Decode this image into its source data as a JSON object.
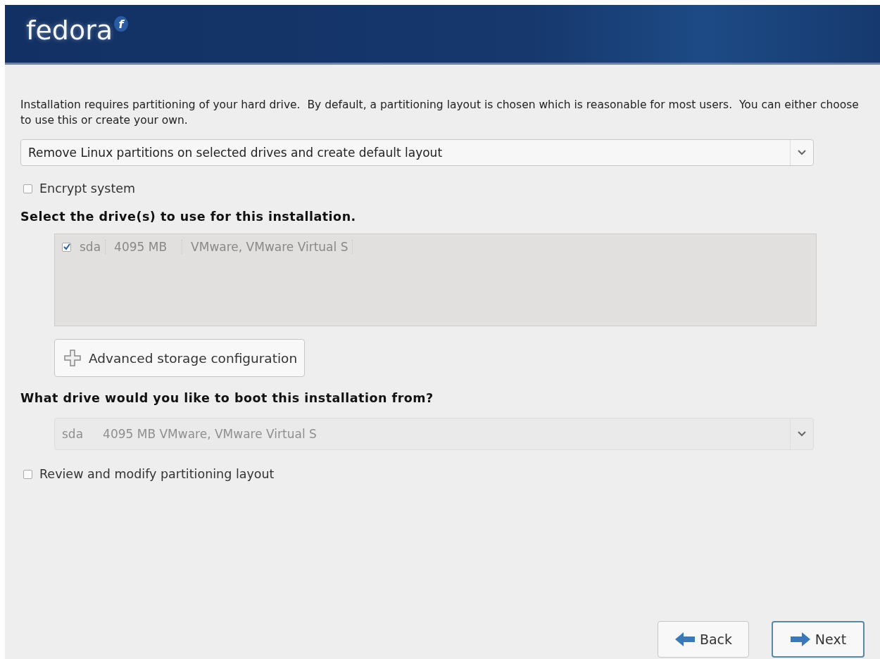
{
  "header": {
    "logo": "fedora",
    "logo_mark": "f"
  },
  "intro": "Installation requires partitioning of your hard drive.  By default, a partitioning layout is chosen which is reasonable for most users.  You can either choose to use this or create your own.",
  "layout_select": {
    "value": "Remove Linux partitions on selected drives and create default layout",
    "disabled": false
  },
  "encrypt": {
    "label": "Encrypt system",
    "checked": false
  },
  "drives_heading": "Select the drive(s) to use for this installation.",
  "drives": {
    "disabled": true,
    "rows": [
      {
        "checked": true,
        "cells": [
          "sda",
          "4095 MB",
          "VMware, VMware Virtual S"
        ]
      }
    ]
  },
  "advanced_button": "Advanced storage configuration",
  "boot_heading": "What drive would you like to boot this installation from?",
  "boot_select": {
    "disabled": true,
    "device": "sda",
    "description": "4095 MB VMware, VMware Virtual S"
  },
  "review": {
    "label": "Review and modify partitioning layout",
    "checked": false
  },
  "buttons": [
    {
      "kind": "back",
      "label": "Back",
      "selected": false
    },
    {
      "kind": "next",
      "label": "Next",
      "selected": true
    }
  ]
}
